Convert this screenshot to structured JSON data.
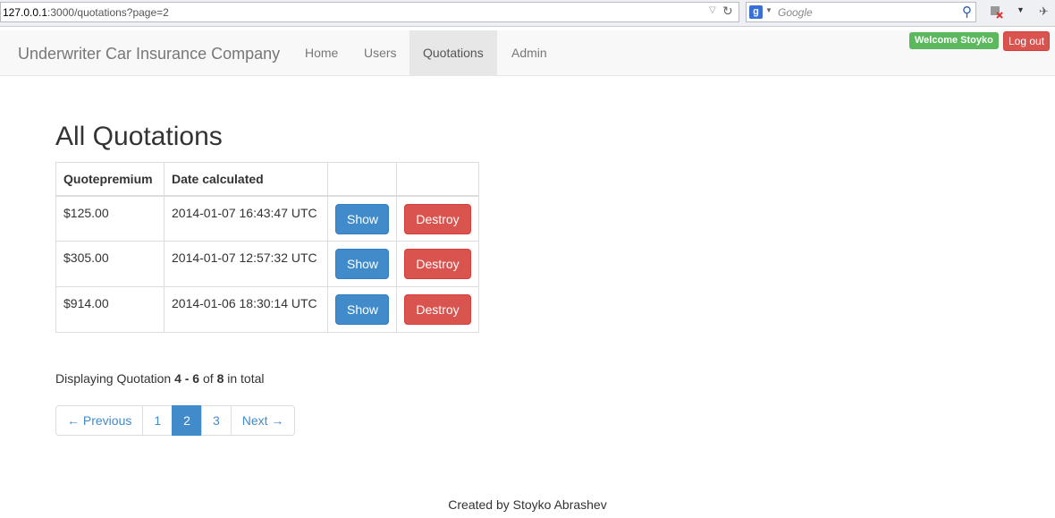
{
  "browser": {
    "url_host": "127.0.0.1",
    "url_path": ":3000/quotations?page=2",
    "search_placeholder": "Google"
  },
  "navbar": {
    "brand": "Underwriter Car Insurance Company",
    "items": [
      {
        "label": "Home"
      },
      {
        "label": "Users"
      },
      {
        "label": "Quotations",
        "active": true
      },
      {
        "label": "Admin"
      }
    ],
    "welcome": "Welcome Stoyko",
    "logout": "Log out"
  },
  "main": {
    "title": "All Quotations",
    "table": {
      "headers": [
        "Quotepremium",
        "Date calculated",
        "",
        ""
      ],
      "rows": [
        {
          "premium": "$125.00",
          "date": "2014-01-07 16:43:47 UTC",
          "show": "Show",
          "destroy": "Destroy"
        },
        {
          "premium": "$305.00",
          "date": "2014-01-07 12:57:32 UTC",
          "show": "Show",
          "destroy": "Destroy"
        },
        {
          "premium": "$914.00",
          "date": "2014-01-06 18:30:14 UTC",
          "show": "Show",
          "destroy": "Destroy"
        }
      ]
    },
    "display_info": {
      "prefix": "Displaying Quotation",
      "range": "4 - 6",
      "of": "of",
      "total": "8",
      "suffix": "in total"
    },
    "pagination": {
      "previous": "← Previous",
      "pages": [
        "1",
        "2",
        "3"
      ],
      "current": "2",
      "next": "Next →"
    }
  },
  "footer": {
    "text": "Created by Stoyko Abrashev"
  },
  "colors": {
    "primary": "#428bca",
    "danger": "#d9534f",
    "success": "#5cb85c",
    "navbar_bg": "#f8f8f8"
  }
}
